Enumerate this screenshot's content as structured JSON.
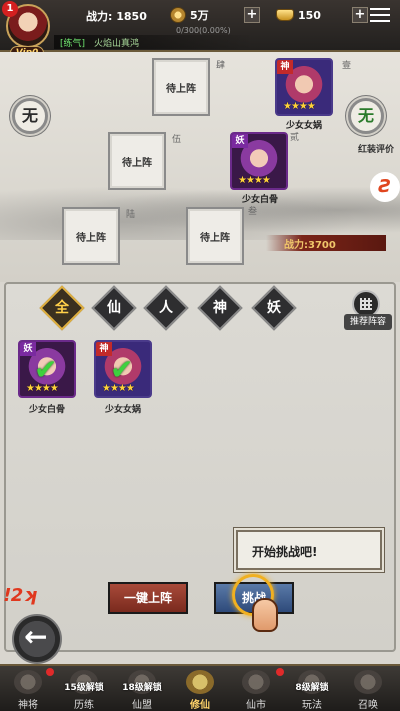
{
  "player": {
    "alert_count": "1",
    "vip": "Vip0",
    "power_label": "战力: 1850",
    "coins": "5万",
    "gold": "150",
    "exp": "0/300(0.00%)",
    "realm_label": "[练气]",
    "realm_name": "火焰山真鸿"
  },
  "formation": {
    "slots": [
      {
        "label": "待上阵",
        "num": "肆"
      },
      {
        "label": "待上阵",
        "num": "伍"
      },
      {
        "label": "待上阵",
        "num": "陆"
      },
      {
        "label": "待上阵",
        "num": ""
      }
    ],
    "heroes": [
      {
        "name": "少女女娲",
        "tag": "神",
        "stars": "★★★★",
        "num": "壹"
      },
      {
        "name": "少女白骨",
        "tag": "妖",
        "stars": "★★★★",
        "num": "叁"
      }
    ],
    "num_er": "贰",
    "left_circle": "无",
    "right_circle": "无",
    "eval_label": "红装评价",
    "power": "战力:3700"
  },
  "filters": [
    "全",
    "仙",
    "人",
    "神",
    "妖"
  ],
  "recommend_label": "推荐阵容",
  "roster": [
    {
      "name": "少女白骨",
      "tag": "妖",
      "stars": "★★★★"
    },
    {
      "name": "少女女娲",
      "tag": "神",
      "stars": "★★★★"
    }
  ],
  "dialog": "开始挑战吧!",
  "buttons": {
    "deploy": "一键上阵",
    "challenge": "挑战"
  },
  "nav": [
    {
      "label": "神将",
      "lock": "",
      "active": false
    },
    {
      "label": "历练",
      "lock": "15级解锁",
      "active": false
    },
    {
      "label": "仙盟",
      "lock": "18级解锁",
      "active": false
    },
    {
      "label": "修仙",
      "lock": "",
      "active": true
    },
    {
      "label": "仙市",
      "lock": "",
      "active": false
    },
    {
      "label": "玩法",
      "lock": "8级解锁",
      "active": false
    },
    {
      "label": "召唤",
      "lock": "",
      "active": false
    }
  ],
  "colors": {
    "accent_gold": "#ffd36a",
    "realm_green": "#6ee46e",
    "deploy_red": "#a84a3a",
    "challenge_blue": "#5a7aa8"
  }
}
